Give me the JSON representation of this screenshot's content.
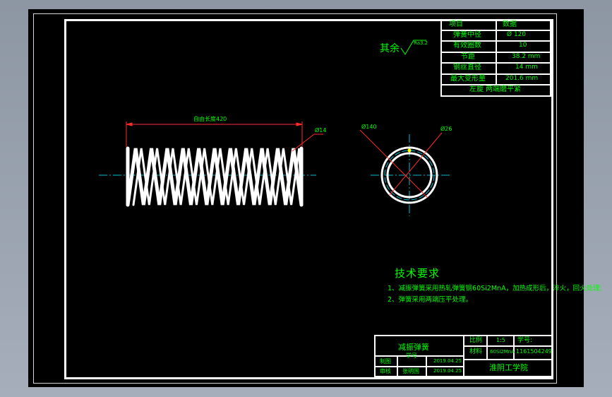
{
  "params": {
    "rows": [
      {
        "label": "项目",
        "value": "数据"
      },
      {
        "label": "弹簧中径",
        "value": "Ø 120"
      },
      {
        "label": "有效圈数",
        "value": "10"
      },
      {
        "label": "节距",
        "value": "38.2 mm"
      },
      {
        "label": "钢丝直径",
        "value": "14 mm"
      },
      {
        "label": "最大变形量",
        "value": "201.6 mm"
      }
    ],
    "note": "左旋 两端磨平紧"
  },
  "roughness": {
    "prefix": "其余",
    "value": "Ra3.2"
  },
  "dimensions": {
    "free_length": "自由长度420",
    "wire_dia": "Ø14",
    "outer_dia": "Ø140",
    "inner_dia": "Ø26"
  },
  "tech": {
    "title": "技术要求",
    "items": [
      "1、减振弹簧采用热轧弹簧钢60Si2MnA，加热成形后，淬火，回火处理;",
      "2、弹簧采用两端压平处理。"
    ]
  },
  "title_block": {
    "part_name": "减振弹簧",
    "scale_label": "比例",
    "scale_value": "1:5",
    "material_label": "材料",
    "material_value": "60Si2MnA",
    "student_no_label": "学号:",
    "student_no": "1161504249",
    "designer_label": "制图",
    "designer_date": "2019.04.25",
    "checker_label": "审核",
    "checker_name": "张明国",
    "checker_date": "2019.04.25",
    "school": "淮阴工学院",
    "drawing_label": "学号"
  }
}
